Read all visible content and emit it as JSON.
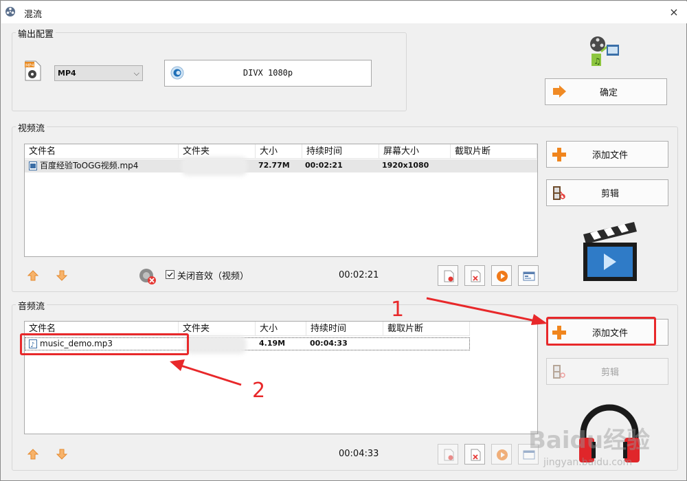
{
  "window": {
    "title": "混流",
    "close_glyph": "×"
  },
  "output": {
    "group_label": "输出配置",
    "format_value": "MP4",
    "codec_label": "DIVX 1080p",
    "confirm_label": "确定"
  },
  "video": {
    "group_label": "视频流",
    "columns": [
      "文件名",
      "文件夹",
      "大小",
      "持续时间",
      "屏幕大小",
      "截取片断"
    ],
    "rows": [
      {
        "name": "百度经验ToOGG视频.mp4",
        "size": "72.77M",
        "duration": "00:02:21",
        "resolution": "1920x1080"
      }
    ],
    "mute_label": "关闭音效（视频）",
    "mute_checked": true,
    "total_time": "00:02:21",
    "add_label": "添加文件",
    "edit_label": "剪辑"
  },
  "audio": {
    "group_label": "音频流",
    "columns": [
      "文件名",
      "文件夹",
      "大小",
      "持续时间",
      "截取片断"
    ],
    "rows": [
      {
        "name": "music_demo.mp3",
        "size": "4.19M",
        "duration": "00:04:33"
      }
    ],
    "total_time": "00:04:33",
    "add_label": "添加文件",
    "edit_label": "剪辑"
  },
  "annotations": {
    "step1": "1",
    "step2": "2",
    "color": "#e8282a"
  },
  "watermark": {
    "text": "Baidu经验",
    "subtext": "jingyan.baidu.com"
  }
}
